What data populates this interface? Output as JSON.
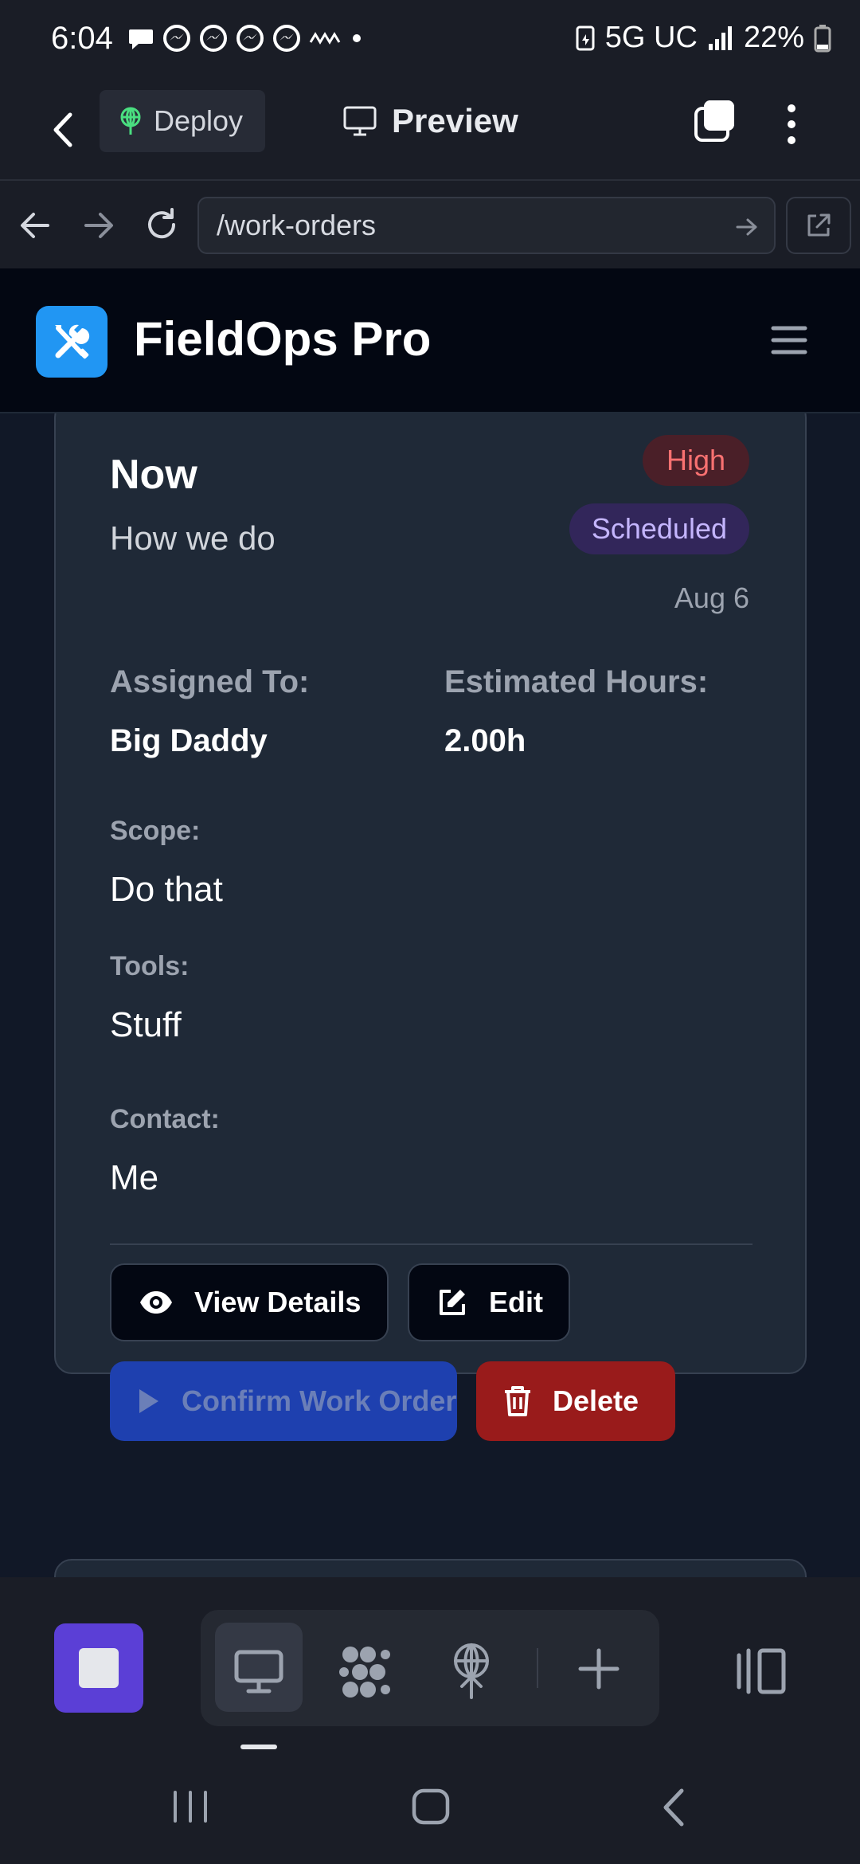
{
  "status_bar": {
    "time": "6:04",
    "network": "5G UC",
    "battery": "22%"
  },
  "app_bar": {
    "deploy_label": "Deploy",
    "preview_label": "Preview"
  },
  "url_bar": {
    "url": "/work-orders"
  },
  "site": {
    "title": "FieldOps Pro"
  },
  "work_order": {
    "title": "Now",
    "description": "How we do",
    "priority": "High",
    "status": "Scheduled",
    "date": "Aug 6",
    "assigned_to_label": "Assigned To:",
    "assigned_to": "Big Daddy",
    "estimated_hours_label": "Estimated Hours:",
    "estimated_hours": "2.00h",
    "scope_label": "Scope:",
    "scope": "Do that",
    "tools_label": "Tools:",
    "tools": "Stuff",
    "contact_label": "Contact:",
    "contact": "Me",
    "actions": {
      "view_details": "View Details",
      "edit": "Edit",
      "confirm": "Confirm Work Order",
      "delete": "Delete"
    }
  },
  "colors": {
    "accent_blue": "#2196f3",
    "priority_high": "#f87171",
    "status_scheduled": "#c4b5fd",
    "delete_red": "#991b1b",
    "confirm_blue": "#1e40af",
    "stop_purple": "#5b3fd6"
  },
  "icons": {
    "logo": "tools-icon",
    "view": "eye-icon",
    "edit": "edit-icon",
    "confirm": "play-icon",
    "delete": "trash-icon"
  }
}
